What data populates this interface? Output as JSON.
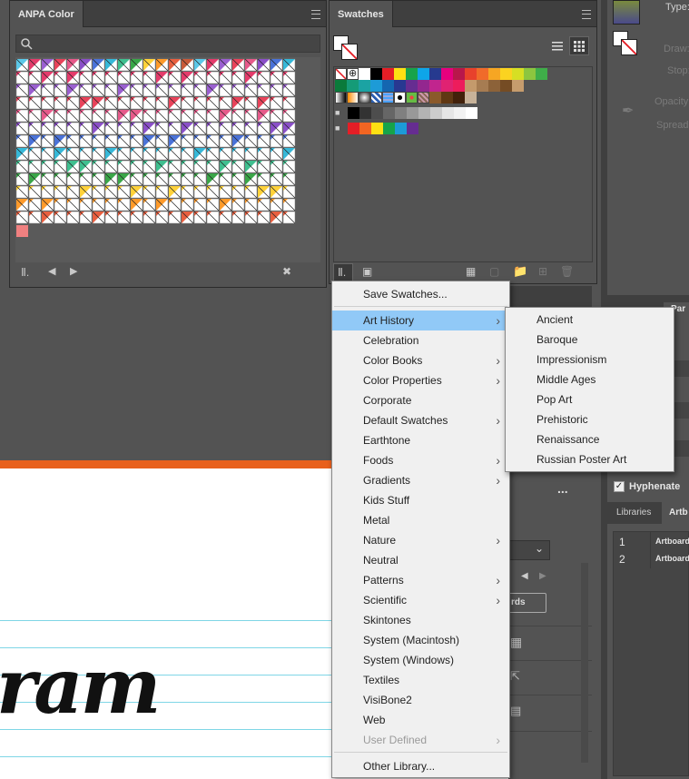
{
  "anpa_panel": {
    "title": "ANPA Color",
    "search_placeholder": "",
    "bottom_icons": [
      "library-icon",
      "prev-arrow-icon",
      "next-arrow-icon",
      "no-tool-icon"
    ]
  },
  "swatches_panel": {
    "title": "Swatches",
    "view_modes": [
      "list-view-icon",
      "grid-view-icon"
    ],
    "row1": [
      "#ffffff",
      "#000000",
      "#e41e26",
      "#fde013",
      "#17a34a",
      "#0ea5e9",
      "#263a8f",
      "#e6007e",
      "#b8174b",
      "#e8412c",
      "#f06b2a",
      "#f6a623",
      "#fbd320",
      "#d7df23",
      "#8cc63f",
      "#3fae49"
    ],
    "row2": [
      "#0a7a3a",
      "#159b77",
      "#1ba3a3",
      "#1d9bd7",
      "#1466b0",
      "#283891",
      "#662d91",
      "#93278f",
      "#c1258e",
      "#e02272",
      "#ed1c5c",
      "#c49a6c",
      "#a67c52",
      "#8c6239",
      "#754c24",
      "#c69c6d"
    ],
    "row3": [
      "#8b5a2b",
      "#603813",
      "#42210b",
      "#c7b299"
    ],
    "row4": [
      "#000000",
      "#333333",
      "#4d4d4d",
      "#666666",
      "#808080",
      "#999999",
      "#b3b3b3",
      "#cccccc",
      "#e6e6e6",
      "#f2f2f2",
      "#ffffff"
    ],
    "row5": [
      "#e41e26",
      "#f26522",
      "#fde013",
      "#17a34a",
      "#1d9bd7",
      "#662d91"
    ],
    "bottom_icons": [
      "library-icon",
      "place-icon",
      "show-kinds-icon",
      "options-icon",
      "new-group-icon",
      "new-swatch-icon",
      "delete-icon"
    ]
  },
  "right_partial": {
    "type_label": "Type:",
    "draw_label": "Draw:",
    "stop_label": "Stop:",
    "opacity_label": "Opacity:",
    "spread_label": "Spread:",
    "par_tab": "Par",
    "hyphenate_label": "Hyphenate",
    "libraries_tab": "Libraries",
    "artboards_tab": "Artb",
    "artboard_rows": [
      {
        "num": "1",
        "name": "Artboard"
      },
      {
        "num": "2",
        "name": "Artboard"
      }
    ],
    "ds_label": "rds",
    "more_dots": "..."
  },
  "canvas": {
    "script_text": "ram"
  },
  "menu": {
    "items": [
      {
        "label": "Save Swatches...",
        "submenu": false,
        "disabled": false
      },
      {
        "label": "Art History",
        "submenu": true,
        "highlight": true
      },
      {
        "label": "Celebration",
        "submenu": false
      },
      {
        "label": "Color Books",
        "submenu": true
      },
      {
        "label": "Color Properties",
        "submenu": true
      },
      {
        "label": "Corporate",
        "submenu": false
      },
      {
        "label": "Default Swatches",
        "submenu": true
      },
      {
        "label": "Earthtone",
        "submenu": false
      },
      {
        "label": "Foods",
        "submenu": true
      },
      {
        "label": "Gradients",
        "submenu": true
      },
      {
        "label": "Kids Stuff",
        "submenu": false
      },
      {
        "label": "Metal",
        "submenu": false
      },
      {
        "label": "Nature",
        "submenu": true
      },
      {
        "label": "Neutral",
        "submenu": false
      },
      {
        "label": "Patterns",
        "submenu": true
      },
      {
        "label": "Scientific",
        "submenu": true
      },
      {
        "label": "Skintones",
        "submenu": false
      },
      {
        "label": "System (Macintosh)",
        "submenu": false
      },
      {
        "label": "System (Windows)",
        "submenu": false
      },
      {
        "label": "Textiles",
        "submenu": false
      },
      {
        "label": "VisiBone2",
        "submenu": false
      },
      {
        "label": "Web",
        "submenu": false
      },
      {
        "label": "User Defined",
        "submenu": true,
        "disabled": true
      },
      {
        "label": "Other Library...",
        "submenu": false
      }
    ]
  },
  "submenu": {
    "items": [
      "Ancient",
      "Baroque",
      "Impressionism",
      "Middle Ages",
      "Pop Art",
      "Prehistoric",
      "Renaissance",
      "Russian Poster Art"
    ]
  },
  "colors": {
    "highlight": "#91c9f7",
    "accent_orange": "#e8601c",
    "guide": "#7fd6e6"
  }
}
